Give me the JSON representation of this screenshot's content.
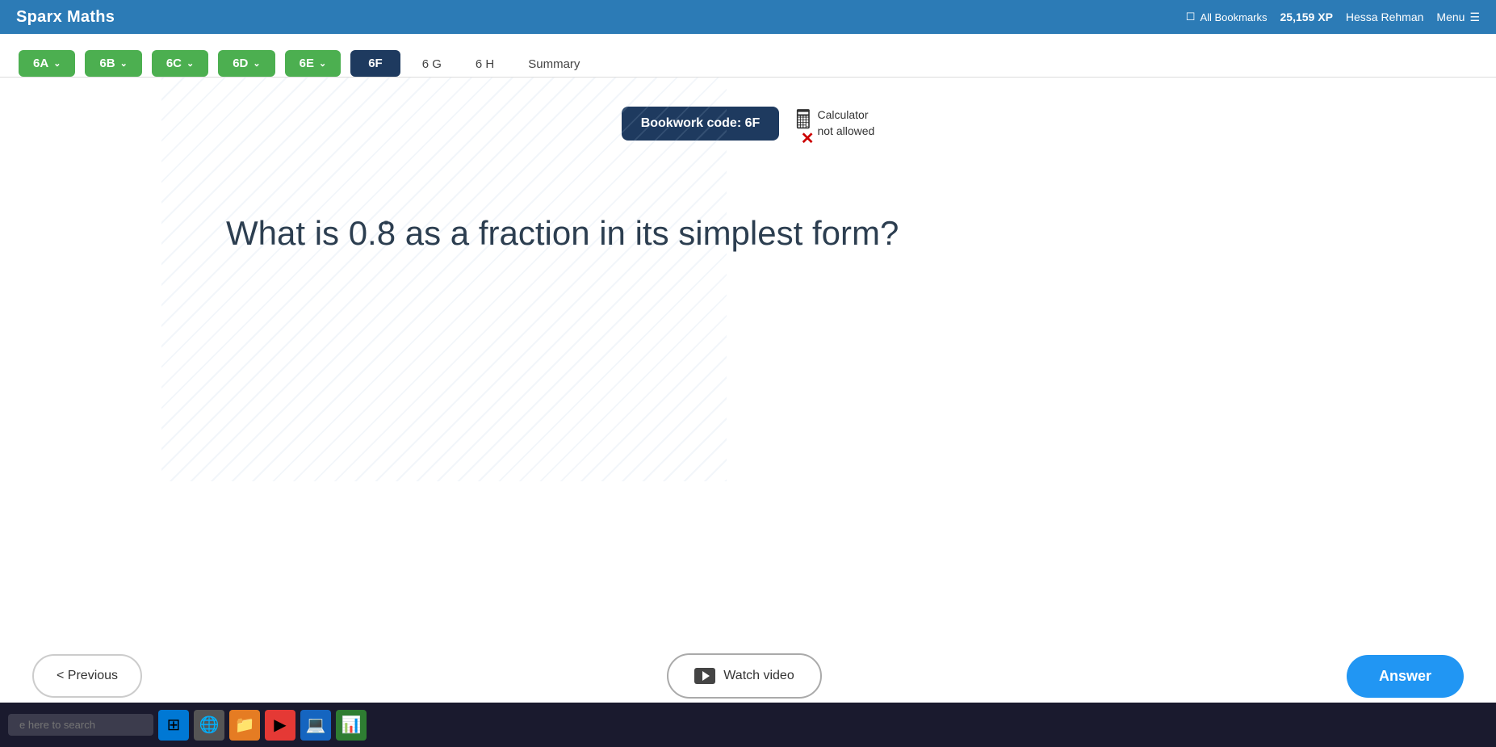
{
  "app": {
    "title": "Sparx Maths"
  },
  "topbar": {
    "bookmark_label": "All Bookmarks",
    "xp": "25,159 XP",
    "user": "Hessa Rehman",
    "menu_label": "Menu"
  },
  "nav": {
    "tabs": [
      {
        "id": "6A",
        "label": "6A",
        "style": "green",
        "has_chevron": true
      },
      {
        "id": "6B",
        "label": "6B",
        "style": "green",
        "has_chevron": true
      },
      {
        "id": "6C",
        "label": "6C",
        "style": "green",
        "has_chevron": true
      },
      {
        "id": "6D",
        "label": "6D",
        "style": "green",
        "has_chevron": true
      },
      {
        "id": "6E",
        "label": "6E",
        "style": "green",
        "has_chevron": true
      },
      {
        "id": "6F",
        "label": "6F",
        "style": "active-dark",
        "has_chevron": false
      },
      {
        "id": "6G",
        "label": "6 G",
        "style": "plain",
        "has_chevron": false
      },
      {
        "id": "6H",
        "label": "6 H",
        "style": "plain",
        "has_chevron": false
      },
      {
        "id": "summary",
        "label": "Summary",
        "style": "plain",
        "has_chevron": false
      }
    ]
  },
  "bookwork": {
    "label": "Bookwork code: 6F",
    "calculator_line1": "Calculator",
    "calculator_line2": "not allowed"
  },
  "question": {
    "text_before": "What is 0.",
    "dot_digit": "8",
    "text_after": " as a fraction in its simplest form?"
  },
  "buttons": {
    "previous": "< Previous",
    "watch_video": "Watch video",
    "answer": "Answer"
  },
  "taskbar": {
    "search_placeholder": "e here to search"
  }
}
